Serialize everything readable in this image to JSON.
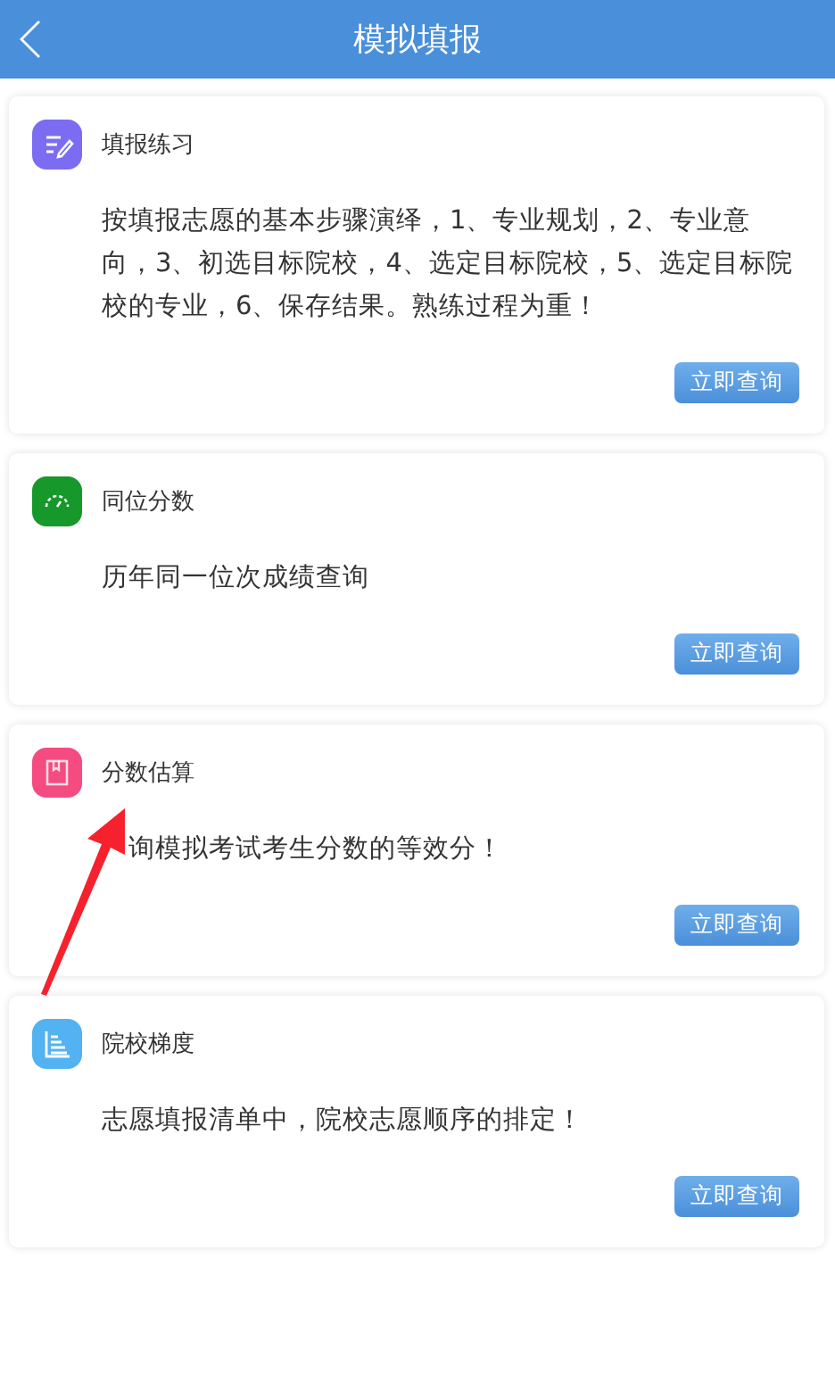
{
  "header": {
    "title": "模拟填报"
  },
  "cards": [
    {
      "kind": "edit",
      "color": "#7b6cf2",
      "title": "填报练习",
      "description": "按填报志愿的基本步骤演绎，1、专业规划，2、专业意向，3、初选目标院校，4、选定目标院校，5、选定目标院校的专业，6、保存结果。熟练过程为重！",
      "button": "立即查询"
    },
    {
      "kind": "gauge",
      "color": "#16982b",
      "title": "同位分数",
      "description": "历年同一位次成绩查询",
      "button": "立即查询"
    },
    {
      "kind": "book",
      "color": "#f44b80",
      "title": "分数估算",
      "description": "询模拟考试考生分数的等效分！",
      "covered": true,
      "button": "立即查询"
    },
    {
      "kind": "bars",
      "color": "#52b2f2",
      "title": "院校梯度",
      "description": "志愿填报清单中，院校志愿顺序的排定！",
      "button": "立即查询"
    }
  ]
}
